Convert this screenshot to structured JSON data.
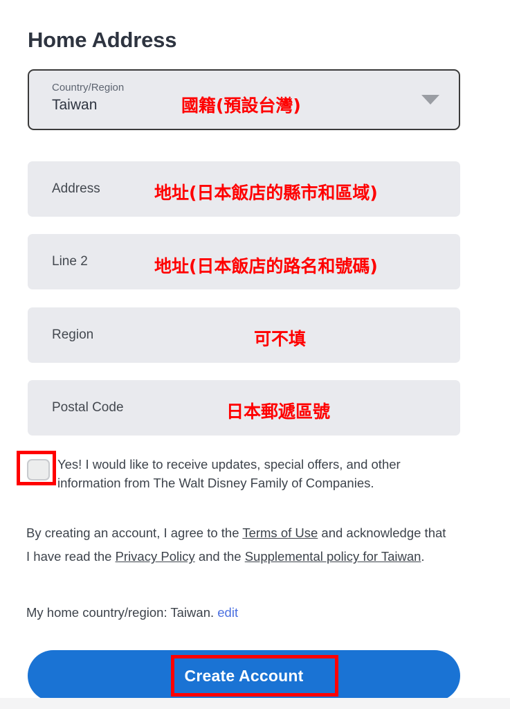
{
  "header": {
    "title": "Home Address"
  },
  "form": {
    "country_select": {
      "caption": "Country/Region",
      "value": "Taiwan",
      "annotation": "國籍(預設台灣)",
      "arrow_icon": "chevron-down-icon"
    },
    "fields": [
      {
        "key": "address",
        "label": "Address",
        "value": "",
        "annotation": "地址(日本飯店的縣市和區域)"
      },
      {
        "key": "line2",
        "label": "Line 2",
        "value": "",
        "annotation": "地址(日本飯店的路名和號碼)"
      },
      {
        "key": "region",
        "label": "Region",
        "value": "",
        "annotation": "可不填"
      },
      {
        "key": "postal",
        "label": "Postal Code",
        "value": "",
        "annotation": "日本郵遞區號"
      }
    ]
  },
  "optin": {
    "checked": false,
    "text": "Yes! I would like to receive updates, special offers, and other information from The Walt Disney Family of Companies."
  },
  "legal": {
    "part1": "By creating an account, I agree to the ",
    "link_terms": "Terms of Use",
    "part2": " and acknowledge that I have read the ",
    "link_privacy": "Privacy Policy",
    "part3": " and the ",
    "link_supplemental": "Supplemental policy for Taiwan",
    "part4": "."
  },
  "home_country": {
    "text": "My home country/region: Taiwan.",
    "edit_label": "edit"
  },
  "cta": {
    "label": "Create Account"
  },
  "colors": {
    "accent_blue": "#1a73d4",
    "annotation_red": "#ff0000",
    "field_bg": "#e9eaee",
    "text": "#3d434b",
    "link_blue": "#4a6fe0"
  }
}
